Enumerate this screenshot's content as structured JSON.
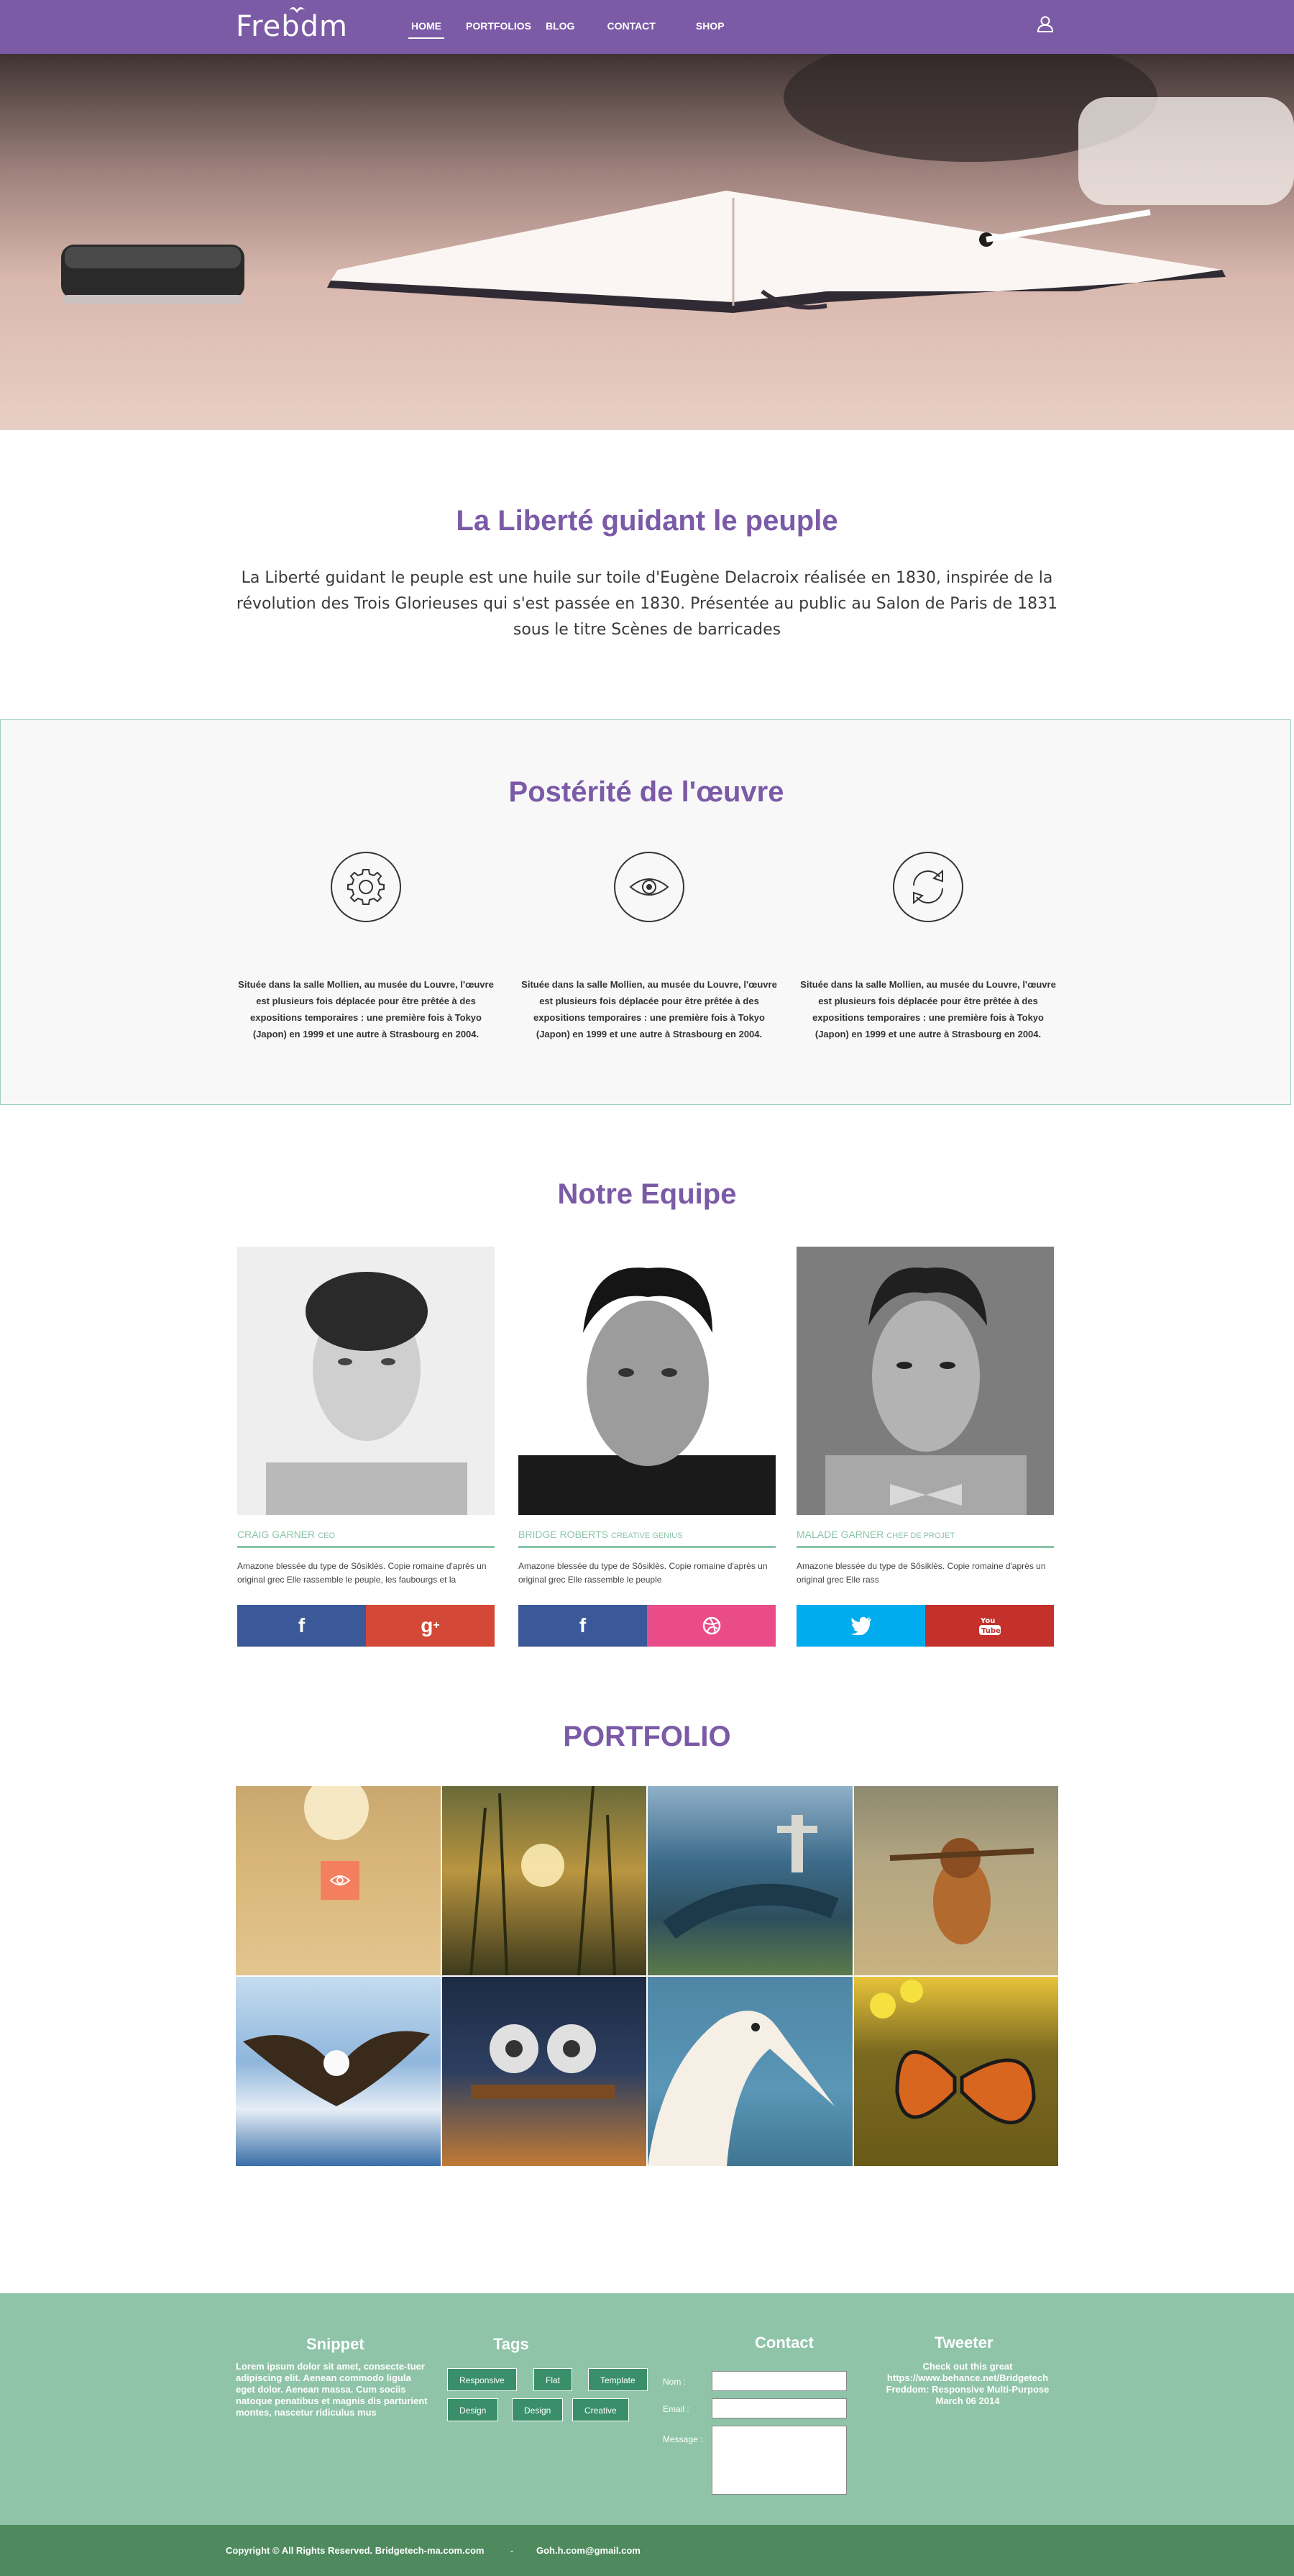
{
  "nav": {
    "logo": "Frebdm",
    "items": [
      "HOME",
      "PORTFOLIOS",
      "BLOG",
      "CONTACT",
      "SHOP"
    ],
    "active": "HOME",
    "user_icon": "user-icon",
    "bg_color": "#7b5aa6"
  },
  "hero": {
    "slides": 3,
    "active_slide": 1
  },
  "intro": {
    "title": "La Liberté guidant le peuple",
    "text": "La Liberté guidant  le peuple est une huile sur toile d'Eugène Delacroix réalisée en 1830, inspirée de la révolution des Trois Glorieuses qui s'est passée en 1830. Présentée au public au Salon de Paris de 1831 sous le titre Scènes de barricades"
  },
  "posterite": {
    "title": "Postérité de l'œuvre",
    "features": [
      {
        "icon": "gear-icon",
        "text": "Située dans la salle Mollien, au musée du Louvre, l'œuvre est plusieurs fois déplacée pour être prêtée à des expositions temporaires : une première fois à Tokyo (Japon) en 1999 et une autre à Strasbourg en 2004."
      },
      {
        "icon": "eye-icon",
        "text": "Située dans la salle Mollien, au musée du Louvre, l'œuvre est plusieurs fois déplacée pour être prêtée à des expositions temporaires : une première fois à Tokyo (Japon) en 1999 et une autre à Strasbourg en 2004."
      },
      {
        "icon": "refresh-icon",
        "text": "Située dans la salle Mollien, au musée du Louvre, l'œuvre est plusieurs fois déplacée pour être prêtée à des expositions temporaires : une première fois à Tokyo (Japon) en 1999 et une autre à Strasbourg en 2004."
      }
    ]
  },
  "team": {
    "title": "Notre Equipe",
    "members": [
      {
        "name": "CRAIG GARNER",
        "role": "CEO",
        "desc": "Amazone blessée du type de Sôsiklès. Copie romaine d'après un original grec Elle rassemble le peuple, les faubourgs et la",
        "social": [
          "facebook-icon",
          "google-plus-icon"
        ]
      },
      {
        "name": "BRIDGE ROBERTS",
        "role": "CREATIVE GENIUS",
        "desc": "Amazone blessée du type de Sôsiklès. Copie romaine d'après un original grec Elle rassemble le peuple",
        "social": [
          "facebook-icon",
          "dribbble-icon"
        ]
      },
      {
        "name": "MALADE GARNER",
        "role": "CHEF DE PROJET",
        "desc": "Amazone blessée du type de Sôsiklès. Copie romaine d'après un original grec Elle rass",
        "social": [
          "twitter-icon",
          "youtube-icon"
        ]
      }
    ],
    "accent": "#8cc4a8"
  },
  "portfolio": {
    "title": "PORTFOLIO",
    "items": [
      "sunset-field",
      "grass-sunset",
      "rio-christ-statue",
      "dog-with-stick",
      "bald-eagle",
      "robots-on-bench",
      "gannet-bird",
      "monarch-butterfly"
    ],
    "overlay_icon": "eye-icon"
  },
  "footer": {
    "snippet": {
      "title": "Snippet",
      "text": "Lorem ipsum dolor sit amet, consecte-tuer adipiscing elit. Aenean commodo ligula eget dolor. Aenean massa. Cum sociis natoque penatibus et magnis dis parturient montes, nascetur ridiculus mus"
    },
    "tags": {
      "title": "Tags",
      "items": [
        "Responsive",
        "Flat",
        "Template",
        "Design",
        "Design",
        "Creative"
      ]
    },
    "contact": {
      "title": "Contact",
      "nom": "Nom :",
      "email": "Email :",
      "message": "Message :"
    },
    "tweeter": {
      "title": "Tweeter",
      "text": "Check out this great https://www.behance.net/Bridgetech Freddom: Responsive Multi-Purpose March 06 2014"
    },
    "copyright": "Copyright © All Rights Reserved. Bridgetech-ma.com.com",
    "separator": "-",
    "email": "Goh.h.com@gmail.com",
    "bg_color": "#8fc4a8",
    "bar_color": "#4e8a5e"
  }
}
